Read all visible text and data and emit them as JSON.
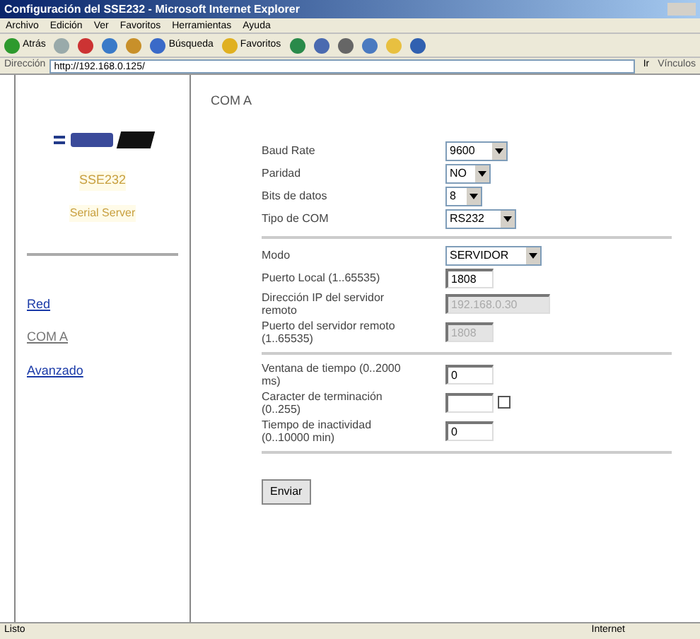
{
  "window": {
    "title": "Configuración del SSE232 - Microsoft Internet Explorer"
  },
  "menu": [
    "Archivo",
    "Edición",
    "Ver",
    "Favoritos",
    "Herramientas",
    "Ayuda"
  ],
  "toolbar": [
    {
      "kind": "back",
      "label": "Atrás"
    },
    {
      "kind": "forward"
    },
    {
      "kind": "stop"
    },
    {
      "kind": "refresh"
    },
    {
      "kind": "home"
    },
    {
      "kind": "search",
      "label": "Búsqueda"
    },
    {
      "kind": "favorites",
      "label": "Favoritos"
    },
    {
      "kind": "history"
    },
    {
      "kind": "mail"
    },
    {
      "kind": "print"
    },
    {
      "kind": "edit"
    },
    {
      "kind": "folder"
    },
    {
      "kind": "messenger"
    }
  ],
  "address": {
    "label": "Dirección",
    "value": "http://192.168.0.125/",
    "go": "Ir",
    "links": "Vínculos"
  },
  "sidebar": {
    "product": "SSE232",
    "subtitle": "Serial Server",
    "links": [
      {
        "label": "Red",
        "selected": false
      },
      {
        "label": "COM A",
        "selected": true
      },
      {
        "label": "Avanzado",
        "selected": false
      }
    ]
  },
  "page_title": "COM A",
  "groups": [
    [
      {
        "label": "Baud Rate",
        "kind": "select",
        "value": "9600",
        "disabled": false
      },
      {
        "label": "Paridad",
        "kind": "select",
        "value": "NO",
        "disabled": false
      },
      {
        "label": "Bits de datos",
        "kind": "select",
        "value": "8",
        "disabled": false
      },
      {
        "label": "Tipo de COM",
        "kind": "select",
        "value": "RS232",
        "disabled": false
      }
    ],
    [
      {
        "label": "Modo",
        "kind": "select",
        "value": "SERVIDOR",
        "disabled": false
      },
      {
        "label": "Puerto Local (1..65535)",
        "kind": "text",
        "value": "1808",
        "disabled": false
      },
      {
        "label": "Dirección IP del servidor remoto",
        "kind": "text",
        "value": "192.168.0.30",
        "disabled": true
      },
      {
        "label": "Puerto del servidor remoto (1..65535)",
        "kind": "text",
        "value": "1808",
        "disabled": true
      }
    ],
    [
      {
        "label": "Ventana de tiempo (0..2000 ms)",
        "kind": "text",
        "value": "0",
        "disabled": false
      },
      {
        "label": "Caracter de terminación (0..255)",
        "kind": "textcheck",
        "disabled": false,
        "checked": false
      },
      {
        "label": "Tiempo de inactividad (0..10000 min)",
        "kind": "text",
        "value": "0",
        "disabled": false
      }
    ]
  ],
  "submit": "Enviar",
  "status_bar": {
    "left": "Listo",
    "zone": "Internet"
  }
}
